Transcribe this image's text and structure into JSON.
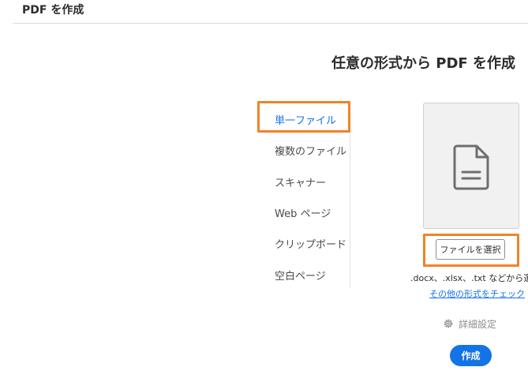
{
  "header": {
    "title": "PDF を作成"
  },
  "main": {
    "heading": "任意の形式から PDF を作成"
  },
  "nav": {
    "items": [
      {
        "label": "単一ファイル",
        "active": true
      },
      {
        "label": "複数のファイル"
      },
      {
        "label": "スキャナー"
      },
      {
        "label": "Web ページ"
      },
      {
        "label": "クリップボード"
      },
      {
        "label": "空白ページ"
      }
    ]
  },
  "file_panel": {
    "icon": "document-icon",
    "select_label": "ファイルを選択",
    "formats_text": ".docx、.xlsx、.txt などから選択",
    "formats_link": "その他の形式をチェック"
  },
  "advanced": {
    "label": "詳細設定",
    "icon": "gear-icon"
  },
  "create_label": "作成",
  "colors": {
    "accent": "#1473e6",
    "highlight": "#f08327"
  }
}
